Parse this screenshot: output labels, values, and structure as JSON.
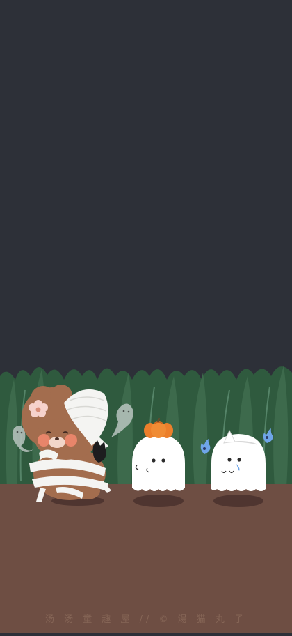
{
  "wallpaper": {
    "colors": {
      "sky": "#2d3038",
      "grass_dark": "#2f5a3e",
      "grass_light": "#467255",
      "ground": "#6e4e43",
      "bear_fur": "#a36d4e",
      "bandage": "#f4f4f2",
      "ghost": "#ffffff",
      "pumpkin": "#ec7f2b",
      "blue_flame": "#6fa5e8",
      "spirit": "#b9c4bf"
    },
    "characters": [
      "bear-mummy",
      "pumpkin-ghost",
      "crying-ghost"
    ],
    "watermark": "汤 汤 童 趣 屋 // © 湯 猫 丸 子"
  }
}
